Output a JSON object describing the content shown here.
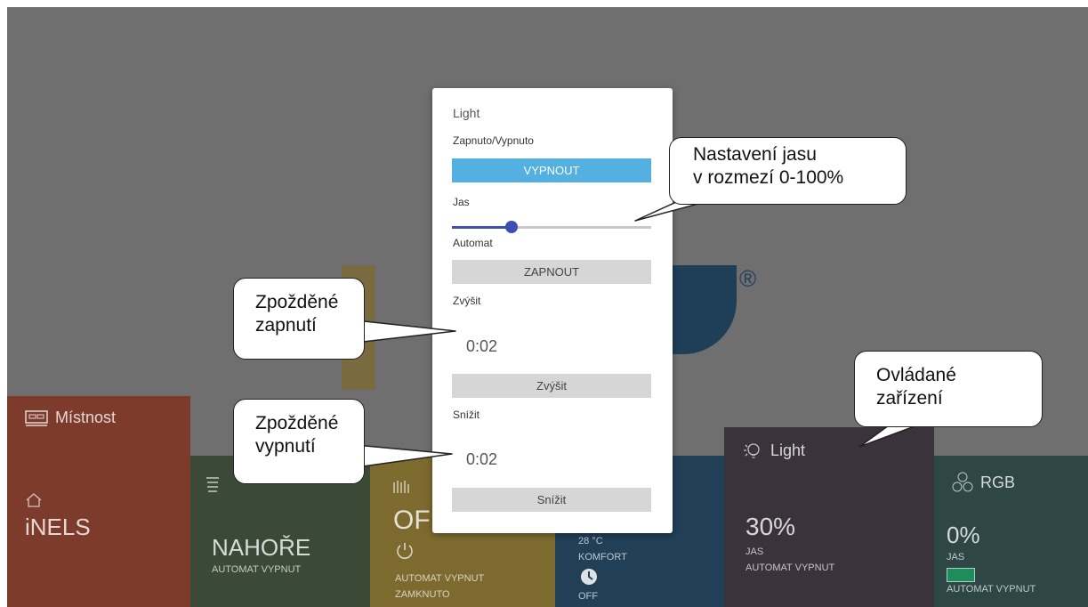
{
  "modal": {
    "title": "Light",
    "onoff_label": "Zapnuto/Vypnuto",
    "onoff_button": "VYPNOUT",
    "brightness_label": "Jas",
    "brightness_value": 0.3,
    "automat_label": "Automat",
    "automat_button": "ZAPNOUT",
    "increase_label": "Zvýšit",
    "increase_delay": "0:02",
    "increase_button": "Zvýšit",
    "decrease_label": "Snížit",
    "decrease_delay": "0:02",
    "decrease_button": "Snížit",
    "accent_color": "#53b0e0",
    "slider_color": "#3d4fb0"
  },
  "tiles": {
    "room": {
      "icon": "bed-icon",
      "title": "Místnost",
      "home_icon": "home-icon",
      "value": "iNELS"
    },
    "blinds": {
      "icon": "blinds-icon",
      "value": "NAHOŘE",
      "status": "AUTOMAT VYPNUT"
    },
    "heating": {
      "icon": "heater-icon",
      "value": "OFF",
      "power_icon": "power-icon",
      "status1": "AUTOMAT VYPNUT",
      "status2": "ZAMKNUTO"
    },
    "climate": {
      "temp": "28 °C",
      "mode": "KOMFORT",
      "clock_icon": "clock-icon",
      "state": "OFF"
    },
    "light": {
      "icon": "bulb-icon",
      "title": "Light",
      "value": "30%",
      "sub": "JAS",
      "status": "AUTOMAT VYPNUT"
    },
    "rgb": {
      "icon": "rgb-icon",
      "title": "RGB",
      "value": "0%",
      "sub": "JAS",
      "swatch": "#1f8c5c",
      "status": "AUTOMAT VYPNUT"
    }
  },
  "background_logo": {
    "registered": "®"
  },
  "callouts": {
    "brightness": {
      "line1": "Nastavení jasu",
      "line2": "v rozmezí 0-100%"
    },
    "delay_on": {
      "line1": "Zpožděné",
      "line2": "zapnutí"
    },
    "delay_off": {
      "line1": "Zpožděné",
      "line2": "vypnutí"
    },
    "devices": {
      "line1": "Ovládané",
      "line2": "zařízení"
    }
  }
}
